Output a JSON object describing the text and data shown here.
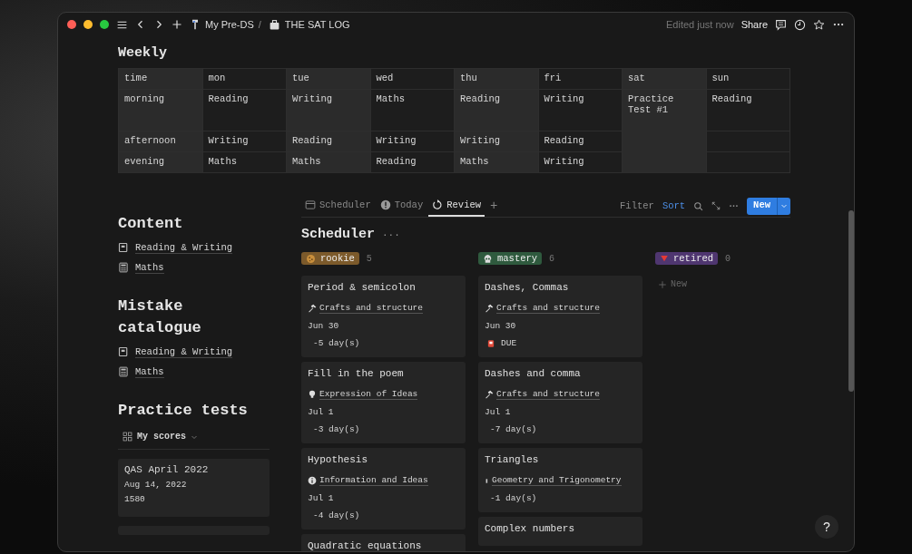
{
  "titlebar": {
    "breadcrumbs": [
      {
        "text": "My Pre-DS",
        "kind": "pin"
      },
      {
        "text": "THE SAT LOG",
        "kind": "bag"
      }
    ],
    "separator": "/",
    "edited": "Edited just now",
    "share": "Share"
  },
  "weekly": {
    "title": "Weekly",
    "columns": [
      {
        "label": "time",
        "shaded": true
      },
      {
        "label": "mon",
        "shaded": false
      },
      {
        "label": "tue",
        "shaded": true
      },
      {
        "label": "wed",
        "shaded": false
      },
      {
        "label": "thu",
        "shaded": true
      },
      {
        "label": "fri",
        "shaded": false
      },
      {
        "label": "sat",
        "shaded": true
      },
      {
        "label": "sun",
        "shaded": false
      }
    ],
    "rows": [
      {
        "cells": [
          {
            "text": "morning"
          },
          {
            "text": "Reading"
          },
          {
            "text": "Writing"
          },
          {
            "text": "Maths"
          },
          {
            "text": "Reading"
          },
          {
            "text": "Writing"
          },
          {
            "text": "Practice Test #1"
          },
          {
            "text": "Reading"
          }
        ]
      },
      {
        "cells": [
          {
            "text": "afternoon"
          },
          {
            "text": "Writing"
          },
          {
            "text": "Reading"
          },
          {
            "text": "Writing"
          },
          {
            "text": "Writing"
          },
          {
            "text": "Reading"
          },
          null,
          null
        ]
      },
      {
        "cells": [
          {
            "text": "evening"
          },
          {
            "text": "Maths"
          },
          {
            "text": "Maths"
          },
          {
            "text": "Reading"
          },
          {
            "text": "Maths"
          },
          {
            "text": "Writing"
          },
          null,
          null
        ]
      }
    ]
  },
  "sidebar": {
    "sections": [
      {
        "title": "Content",
        "items": [
          {
            "text": "Reading & Writing",
            "kind": "book"
          },
          {
            "text": "Maths",
            "kind": "calculator"
          }
        ]
      },
      {
        "title": "Mistake catalogue",
        "items": [
          {
            "text": "Reading & Writing",
            "kind": "book"
          },
          {
            "text": "Maths",
            "kind": "calculator"
          }
        ]
      }
    ],
    "practice": {
      "title": "Practice tests",
      "view": "My scores",
      "cards": [
        {
          "title": "QAS April 2022",
          "date": "Aug 14, 2022",
          "score": "1580"
        }
      ]
    }
  },
  "board": {
    "tabs": [
      {
        "label": "Scheduler",
        "kind": "table",
        "selected": false
      },
      {
        "label": "Today",
        "kind": "alert",
        "selected": false
      },
      {
        "label": "Review",
        "kind": "refresh",
        "selected": true
      }
    ],
    "add_tab": "+",
    "filter": {
      "label": "Filter",
      "active": false
    },
    "sort": {
      "label": "Sort",
      "active": true
    },
    "new_button": "New",
    "title": "Scheduler",
    "title_menu": "···",
    "columns": [
      {
        "name": "rookie",
        "count": "5",
        "color": "#7c5a2b",
        "kind": "cookie",
        "cards": [
          {
            "title": "Period & semicolon",
            "tag": {
              "text": "Crafts and structure",
              "kind": "hammer"
            },
            "date": "Jun 30",
            "status": {
              "text": "-5 day(s)",
              "due": false
            }
          },
          {
            "title": "Fill in the poem",
            "tag": {
              "text": "Expression of Ideas",
              "kind": "bulb"
            },
            "date": "Jul 1",
            "status": {
              "text": "-3 day(s)",
              "due": false
            }
          },
          {
            "title": "Hypothesis",
            "tag": {
              "text": "Information and Ideas",
              "kind": "info"
            },
            "date": "Jul 1",
            "status": {
              "text": "-4 day(s)",
              "due": false
            }
          },
          {
            "title": "Quadratic equations"
          }
        ]
      },
      {
        "name": "mastery",
        "count": "6",
        "color": "#2f5a3e",
        "kind": "skull",
        "cards": [
          {
            "title": "Dashes, Commas",
            "tag": {
              "text": "Crafts and structure",
              "kind": "hammer"
            },
            "date": "Jun 30",
            "status": {
              "text": "DUE",
              "due": true
            }
          },
          {
            "title": "Dashes and comma",
            "tag": {
              "text": "Crafts and structure",
              "kind": "hammer"
            },
            "date": "Jul 1",
            "status": {
              "text": "-7 day(s)",
              "due": false
            }
          },
          {
            "title": "Triangles",
            "tag": {
              "text": "Geometry and Trigonometry",
              "kind": "ruler"
            },
            "status": {
              "text": "-1 day(s)",
              "due": false
            }
          },
          {
            "title": "Complex numbers"
          }
        ]
      },
      {
        "name": "retired",
        "count": "0",
        "color": "#4f3670",
        "kind": "triangle",
        "add_label": "New"
      }
    ]
  },
  "help": "?"
}
